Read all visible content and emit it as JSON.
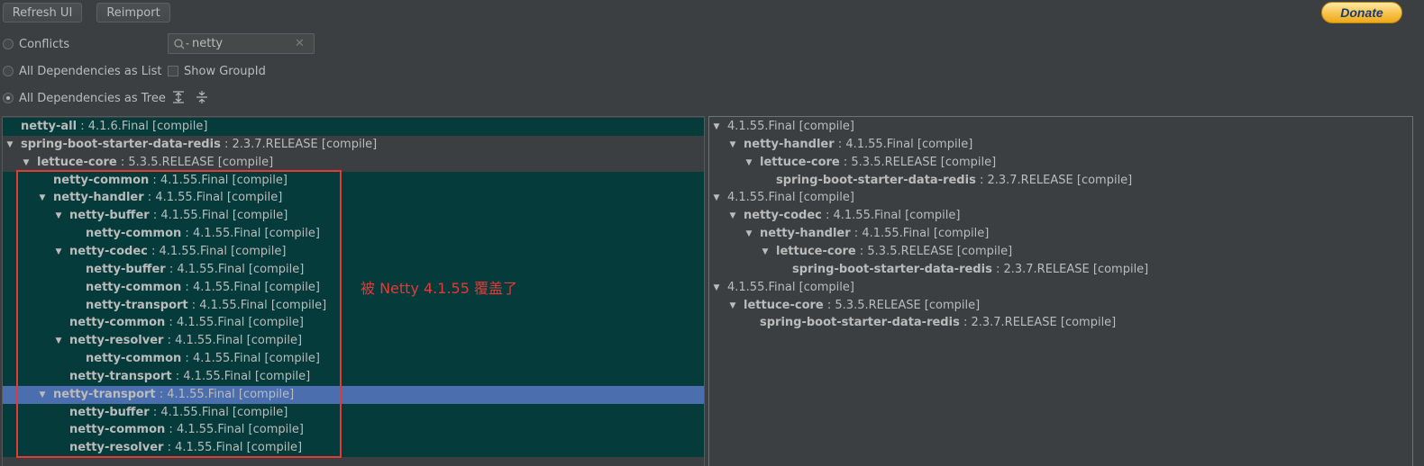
{
  "toolbar": {
    "refresh_label": "Refresh UI",
    "reimport_label": "Reimport",
    "donate_label": "Donate"
  },
  "view_modes": {
    "conflicts": "Conflicts",
    "list": "All Dependencies as List",
    "tree": "All Dependencies as Tree",
    "selected": "tree"
  },
  "search": {
    "value": "netty",
    "placeholder": ""
  },
  "show_groupid": {
    "label": "Show GroupId",
    "checked": false
  },
  "left_tree": [
    {
      "name": "netty-all",
      "version": "4.1.6.Final [compile]",
      "depth": 0,
      "expanded": null,
      "bg": "teal"
    },
    {
      "name": "spring-boot-starter-data-redis",
      "version": "2.3.7.RELEASE [compile]",
      "depth": 0,
      "expanded": true,
      "bg": ""
    },
    {
      "name": "lettuce-core",
      "version": "5.3.5.RELEASE [compile]",
      "depth": 1,
      "expanded": true,
      "bg": ""
    },
    {
      "name": "netty-common",
      "version": "4.1.55.Final [compile]",
      "depth": 2,
      "expanded": null,
      "bg": "teal"
    },
    {
      "name": "netty-handler",
      "version": "4.1.55.Final [compile]",
      "depth": 2,
      "expanded": true,
      "bg": "teal"
    },
    {
      "name": "netty-buffer",
      "version": "4.1.55.Final [compile]",
      "depth": 3,
      "expanded": true,
      "bg": "teal"
    },
    {
      "name": "netty-common",
      "version": "4.1.55.Final [compile]",
      "depth": 4,
      "expanded": null,
      "bg": "teal"
    },
    {
      "name": "netty-codec",
      "version": "4.1.55.Final [compile]",
      "depth": 3,
      "expanded": true,
      "bg": "teal"
    },
    {
      "name": "netty-buffer",
      "version": "4.1.55.Final [compile]",
      "depth": 4,
      "expanded": null,
      "bg": "teal"
    },
    {
      "name": "netty-common",
      "version": "4.1.55.Final [compile]",
      "depth": 4,
      "expanded": null,
      "bg": "teal"
    },
    {
      "name": "netty-transport",
      "version": "4.1.55.Final [compile]",
      "depth": 4,
      "expanded": null,
      "bg": "teal"
    },
    {
      "name": "netty-common",
      "version": "4.1.55.Final [compile]",
      "depth": 3,
      "expanded": null,
      "bg": "teal"
    },
    {
      "name": "netty-resolver",
      "version": "4.1.55.Final [compile]",
      "depth": 3,
      "expanded": true,
      "bg": "teal"
    },
    {
      "name": "netty-common",
      "version": "4.1.55.Final [compile]",
      "depth": 4,
      "expanded": null,
      "bg": "teal"
    },
    {
      "name": "netty-transport",
      "version": "4.1.55.Final [compile]",
      "depth": 3,
      "expanded": null,
      "bg": "teal"
    },
    {
      "name": "netty-transport",
      "version": "4.1.55.Final [compile]",
      "depth": 2,
      "expanded": true,
      "bg": "sel"
    },
    {
      "name": "netty-buffer",
      "version": "4.1.55.Final [compile]",
      "depth": 3,
      "expanded": null,
      "bg": "teal"
    },
    {
      "name": "netty-common",
      "version": "4.1.55.Final [compile]",
      "depth": 3,
      "expanded": null,
      "bg": "teal"
    },
    {
      "name": "netty-resolver",
      "version": "4.1.55.Final [compile]",
      "depth": 3,
      "expanded": null,
      "bg": "teal"
    }
  ],
  "right_tree": [
    {
      "name": "",
      "version": "4.1.55.Final [compile]",
      "depth": 0,
      "expanded": true
    },
    {
      "name": "netty-handler",
      "version": "4.1.55.Final [compile]",
      "depth": 1,
      "expanded": true
    },
    {
      "name": "lettuce-core",
      "version": "5.3.5.RELEASE [compile]",
      "depth": 2,
      "expanded": true
    },
    {
      "name": "spring-boot-starter-data-redis",
      "version": "2.3.7.RELEASE [compile]",
      "depth": 3,
      "expanded": null
    },
    {
      "name": "",
      "version": "4.1.55.Final [compile]",
      "depth": 0,
      "expanded": true
    },
    {
      "name": "netty-codec",
      "version": "4.1.55.Final [compile]",
      "depth": 1,
      "expanded": true
    },
    {
      "name": "netty-handler",
      "version": "4.1.55.Final [compile]",
      "depth": 2,
      "expanded": true
    },
    {
      "name": "lettuce-core",
      "version": "5.3.5.RELEASE [compile]",
      "depth": 3,
      "expanded": true
    },
    {
      "name": "spring-boot-starter-data-redis",
      "version": "2.3.7.RELEASE [compile]",
      "depth": 4,
      "expanded": null
    },
    {
      "name": "",
      "version": "4.1.55.Final [compile]",
      "depth": 0,
      "expanded": true
    },
    {
      "name": "lettuce-core",
      "version": "5.3.5.RELEASE [compile]",
      "depth": 1,
      "expanded": true
    },
    {
      "name": "spring-boot-starter-data-redis",
      "version": "2.3.7.RELEASE [compile]",
      "depth": 2,
      "expanded": null
    }
  ],
  "annotation": "被 Netty 4.1.55 覆盖了",
  "colors": {
    "teal_row": "#053b3b",
    "selected_row": "#4b6eaf",
    "annotation": "#e53935"
  }
}
